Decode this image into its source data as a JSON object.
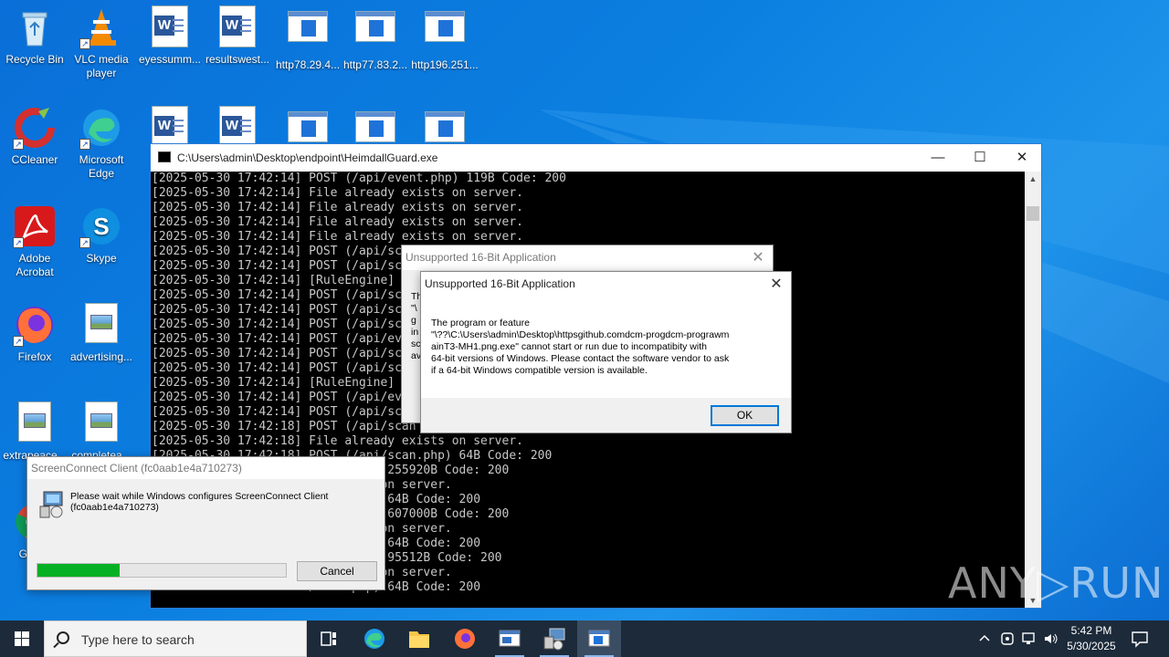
{
  "desktop": {
    "icons": [
      {
        "label": "Recycle Bin"
      },
      {
        "label": "VLC media player"
      },
      {
        "label": "eyessumm..."
      },
      {
        "label": "resultswest..."
      },
      {
        "label": "http78.29.4..."
      },
      {
        "label": "http77.83.2..."
      },
      {
        "label": "http196.251..."
      },
      {
        "label": "CCleaner"
      },
      {
        "label": "Microsoft Edge"
      },
      {
        "label": "Adobe Acrobat"
      },
      {
        "label": "Skype"
      },
      {
        "label": "Firefox"
      },
      {
        "label": "advertising..."
      },
      {
        "label": "extrapeace..."
      },
      {
        "label": "completea..."
      },
      {
        "label": "Go Ch"
      }
    ]
  },
  "console": {
    "title": "C:\\Users\\admin\\Desktop\\endpoint\\HeimdallGuard.exe",
    "lines": [
      "[2025-05-30 17:42:14] POST (/api/event.php) 119B Code: 200",
      "[2025-05-30 17:42:14] File already exists on server.",
      "[2025-05-30 17:42:14] File already exists on server.",
      "[2025-05-30 17:42:14] File already exists on server.",
      "[2025-05-30 17:42:14] File already exists on server.",
      "[2025-05-30 17:42:14] POST (/api/sc",
      "[2025-05-30 17:42:14] POST (/api/sc",
      "[2025-05-30 17:42:14] [RuleEngine]",
      "[2025-05-30 17:42:14] POST (/api/sc",
      "[2025-05-30 17:42:14] POST (/api/sc",
      "[2025-05-30 17:42:14] POST (/api/sc",
      "[2025-05-30 17:42:14] POST (/api/ev",
      "[2025-05-30 17:42:14] POST (/api/sc",
      "[2025-05-30 17:42:14] POST (/api/sc",
      "[2025-05-30 17:42:14] [RuleEngine]",
      "[2025-05-30 17:42:14] POST (/api/ev",
      "[2025-05-30 17:42:14] POST (/api/sc",
      "[2025-05-30 17:42:18] POST (/api/scan",
      "[2025-05-30 17:42:18] File already exists on server.",
      "[2025-05-30 17:42:18] POST (/api/scan.php) 64B Code: 200",
      "                      /scan.php) 255920B Code: 200",
      "                      dy exists on server.",
      "                      /scan.php) 64B Code: 200",
      "                      /scan.php) 607000B Code: 200",
      "                      dy exists on server.",
      "                      /scan.php) 64B Code: 200",
      "                      /scan.php) 95512B Code: 200",
      "                      dy exists on server.",
      "                      /scan.php) 64B Code: 200"
    ],
    "minimize": "—",
    "maximize": "☐",
    "close": "✕"
  },
  "dialog_back": {
    "title": "Unsupported 16-Bit Application",
    "fragments": [
      "Th",
      "\"\\",
      "g",
      "in",
      "sc",
      "av"
    ]
  },
  "dialog_front": {
    "title": "Unsupported 16-Bit Application",
    "message_line1": "The program or feature",
    "message_line2": "\"\\??\\C:\\Users\\admin\\Desktop\\httpsgithub.comdcm-progdcm-prograwm",
    "message_line3": "ainT3-MH1.png.exe\" cannot start or run due to incompatibity with",
    "message_line4": "64-bit versions of Windows. Please contact the software vendor to ask",
    "message_line5": "if a 64-bit Windows compatible version is available.",
    "ok_label": "OK"
  },
  "screenconnect": {
    "title": "ScreenConnect Client (fc0aab1e4a710273)",
    "message_line1": "Please wait while Windows configures ScreenConnect Client",
    "message_line2": "(fc0aab1e4a710273)",
    "progress_fraction": 0.33,
    "cancel_label": "Cancel"
  },
  "watermark": "ANY▷RUN",
  "taskbar": {
    "search_placeholder": "Type here to search",
    "clock_time": "5:42 PM",
    "clock_date": "5/30/2025"
  }
}
